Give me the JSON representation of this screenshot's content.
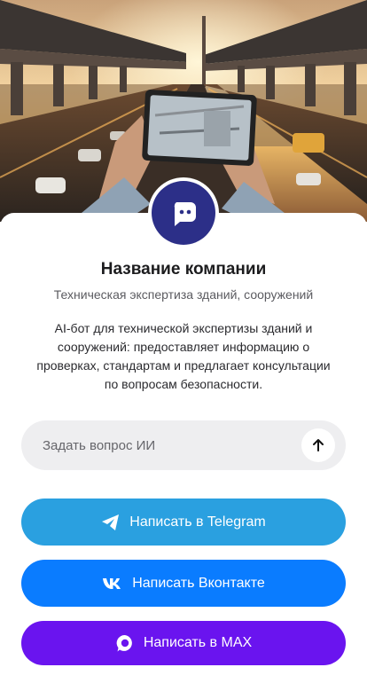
{
  "profile": {
    "company_name": "Название компании",
    "subtitle": "Техническая экспертиза зданий, сооружений",
    "description": "AI-бот для технической экспертизы зданий и сооружений: предоставляет информацию о проверках, стандартам и предлагает консультации по вопросам безопасности."
  },
  "ask": {
    "placeholder": "Задать вопрос ИИ",
    "send_icon": "arrow-up-icon"
  },
  "buttons": {
    "telegram": {
      "label": "Написать в Telegram",
      "icon": "telegram-icon",
      "color": "#2aa0e0"
    },
    "vk": {
      "label": "Написать Вконтакте",
      "icon": "vk-icon",
      "color": "#0a7cff"
    },
    "max": {
      "label": "Написать в MAX",
      "icon": "max-icon",
      "color": "#6a14ef"
    }
  },
  "colors": {
    "avatar_bg": "#2c2f88"
  }
}
